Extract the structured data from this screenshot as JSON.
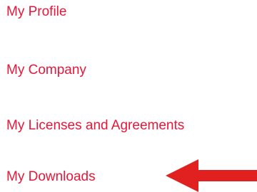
{
  "menu": {
    "items": [
      {
        "label": "My Profile"
      },
      {
        "label": "My Company"
      },
      {
        "label": "My Licenses and Agreements"
      },
      {
        "label": "My Downloads"
      }
    ]
  },
  "annotation": {
    "icon": "arrow-left-icon",
    "color": "#e0211f"
  },
  "colors": {
    "link": "#e8173a",
    "background": "#ffffff"
  }
}
